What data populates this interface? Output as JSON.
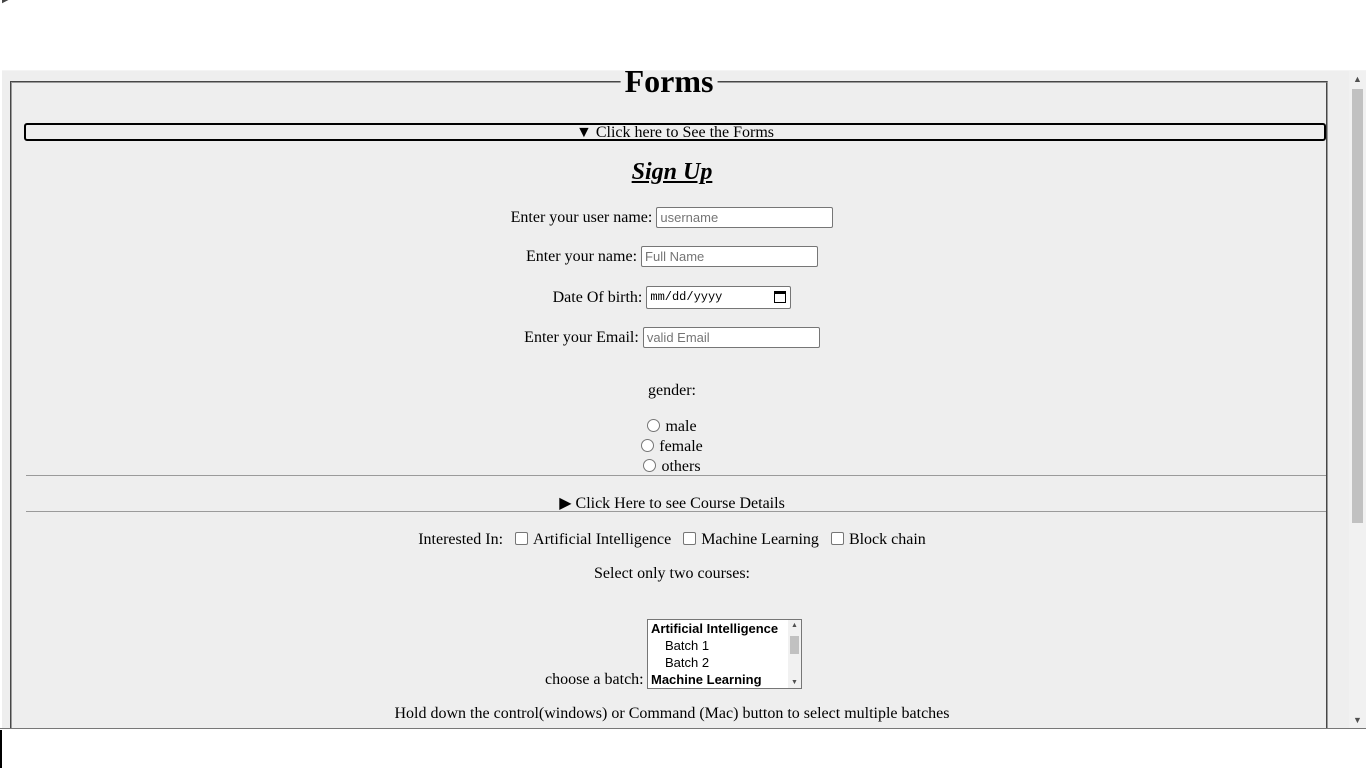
{
  "page": {
    "legend": "Forms",
    "forms_summary": "Click here to See the Forms",
    "forms_summary_marker": "▼"
  },
  "signup": {
    "title": "Sign Up",
    "username": {
      "label": "Enter your user name:",
      "placeholder": "username"
    },
    "fullname": {
      "label": "Enter your name:",
      "placeholder": "Full Name"
    },
    "dob": {
      "label": "Date Of birth:",
      "placeholder": "mm/dd/yyyy"
    },
    "email": {
      "label": "Enter your Email:",
      "placeholder": "valid Email"
    },
    "gender": {
      "label": "gender:",
      "options": [
        "male",
        "female",
        "others"
      ]
    }
  },
  "course_details": {
    "summary": "Click Here to see Course Details",
    "marker": "▶"
  },
  "interests": {
    "label": "Interested In:",
    "options": [
      "Artificial Intelligence",
      "Machine Learning",
      "Block chain"
    ]
  },
  "courses": {
    "instruction": "Select only two courses:"
  },
  "batch": {
    "label": "choose a batch:",
    "items": [
      {
        "text": "Artificial Intelligence",
        "kind": "group"
      },
      {
        "text": "Batch 1",
        "kind": "option"
      },
      {
        "text": "Batch 2",
        "kind": "option"
      },
      {
        "text": "Machine Learning",
        "kind": "group"
      }
    ],
    "hint": "Hold down the control(windows) or Command (Mac) button to select multiple batches"
  }
}
